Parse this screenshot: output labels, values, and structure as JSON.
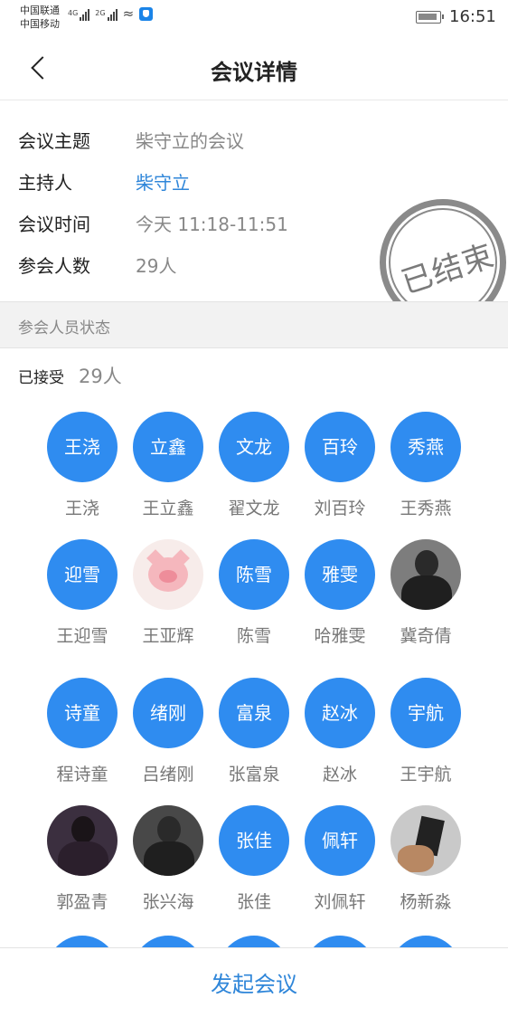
{
  "status_bar": {
    "carrier1": "中国联通",
    "carrier2": "中国移动",
    "net1": "4G",
    "net2": "2G",
    "time": "16:51"
  },
  "nav": {
    "title": "会议详情"
  },
  "info": {
    "topic_label": "会议主题",
    "topic_value": "柴守立的会议",
    "host_label": "主持人",
    "host_value": "柴守立",
    "time_label": "会议时间",
    "time_value": "今天 11:18-11:51",
    "count_label": "参会人数",
    "count_value": "29人",
    "stamp": "已结束"
  },
  "section": {
    "title": "参会人员状态"
  },
  "accepted": {
    "label": "已接受",
    "count": "29人"
  },
  "participants": [
    {
      "avatar_text": "王浇",
      "name": "王浇"
    },
    {
      "avatar_text": "立鑫",
      "name": "王立鑫"
    },
    {
      "avatar_text": "文龙",
      "name": "翟文龙"
    },
    {
      "avatar_text": "百玲",
      "name": "刘百玲"
    },
    {
      "avatar_text": "秀燕",
      "name": "王秀燕"
    },
    {
      "avatar_text": "迎雪",
      "name": "王迎雪"
    },
    {
      "avatar_text": "",
      "name": "王亚辉"
    },
    {
      "avatar_text": "陈雪",
      "name": "陈雪"
    },
    {
      "avatar_text": "雅雯",
      "name": "哈雅雯"
    },
    {
      "avatar_text": "",
      "name": "冀奇倩"
    },
    {
      "avatar_text": "诗童",
      "name": "程诗童"
    },
    {
      "avatar_text": "绪刚",
      "name": "吕绪刚"
    },
    {
      "avatar_text": "富泉",
      "name": "张富泉"
    },
    {
      "avatar_text": "赵冰",
      "name": "赵冰"
    },
    {
      "avatar_text": "宇航",
      "name": "王宇航"
    },
    {
      "avatar_text": "",
      "name": "郭盈青"
    },
    {
      "avatar_text": "",
      "name": "张兴海"
    },
    {
      "avatar_text": "张佳",
      "name": "张佳"
    },
    {
      "avatar_text": "佩轩",
      "name": "刘佩轩"
    },
    {
      "avatar_text": "",
      "name": "杨新淼"
    }
  ],
  "bottom": {
    "button": "发起会议"
  },
  "colors": {
    "accent": "#2f86d9",
    "avatar": "#2f8cf0"
  }
}
